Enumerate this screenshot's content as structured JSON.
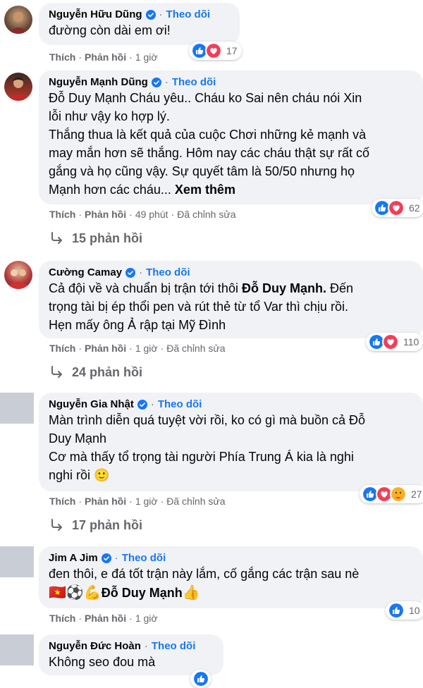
{
  "ui": {
    "verified_icon": "verified-badge-icon",
    "follow_label": "Theo dõi",
    "separator": "·",
    "like_label": "Thích",
    "reply_label": "Phản hồi",
    "colors": {
      "bubble": "#f0f2f5",
      "follow": "#1877f2",
      "meta": "#65676b",
      "like": "#1877f2",
      "love": "#f33e58"
    }
  },
  "comments": [
    {
      "name": "Nguyễn Hữu Dũng",
      "lines": [
        "đường còn dài em ơi!"
      ],
      "time": "1 giờ",
      "edited": "",
      "reactions": [
        "like-icon",
        "love-icon"
      ],
      "reaction_count": "17"
    },
    {
      "name": "Nguyễn Mạnh Dũng",
      "lines": [
        "Đỗ Duy Mạnh Cháu yêu.. Cháu ko Sai nên cháu nói Xin",
        "lỗi như vậy ko hợp lý.",
        "Thắng thua là kết quả của cuộc Chơi những kẻ mạnh và",
        "may mắn hơn sẽ thắng. Hôm nay các cháu thật sự rất cố",
        "gắng và họ cũng vậy. Sự quyết tâm là 50/50 nhưng họ",
        "Mạnh hơn các cháu..."
      ],
      "see_more": "Xem thêm",
      "time": "49 phút",
      "edited": "Đã chỉnh sửa",
      "reactions": [
        "like-icon",
        "love-icon"
      ],
      "reaction_count": "62",
      "replies": "15 phản hồi"
    },
    {
      "name": "Cường Camay",
      "lines": [
        "Cả đội về và chuẩn bị trận tới thôi",
        "trọng tài bị ép thổi pen và rút thẻ từ tổ Var thì chịu rồi.",
        "Hẹn mấy ông Ả rập tại Mỹ Đình"
      ],
      "mention": "Đỗ Duy Mạnh.",
      "mention_after": "Đến",
      "time": "1 giờ",
      "edited": "Đã chỉnh sửa",
      "reactions": [
        "like-icon",
        "love-icon"
      ],
      "reaction_count": "110",
      "replies": "24 phản hồi"
    },
    {
      "name": "Nguyễn Gia Nhật",
      "lines": [
        "Màn trình diễn quá tuyệt vời rồi, ko có gì mà buồn cả Đỗ",
        "Duy Mạnh",
        "Cơ mà thấy tổ trọng tài người Phía Trung Á kia là nghi",
        "nghi rồi"
      ],
      "emoji": "🙂",
      "time": "1 giờ",
      "edited": "Đã chỉnh sửa",
      "reactions": [
        "like-icon",
        "love-icon",
        "care-icon"
      ],
      "reaction_count": "27",
      "replies": "17 phản hồi"
    },
    {
      "name": "Jim A Jim",
      "lines": [
        "đen thôi, e đá tốt trận này lắm, cố gắng các trận sau nè"
      ],
      "emoji_line": "🇻🇳⚽💪",
      "mention": "Đỗ Duy Mạnh",
      "emoji_after": "👍",
      "time": "1 giờ",
      "edited": "",
      "reactions": [
        "like-icon"
      ],
      "reaction_count": "10"
    },
    {
      "name": "Nguyễn Đức Hoàn",
      "lines": [
        "Không seo đou mà"
      ],
      "reactions": [
        "like-icon"
      ]
    }
  ]
}
